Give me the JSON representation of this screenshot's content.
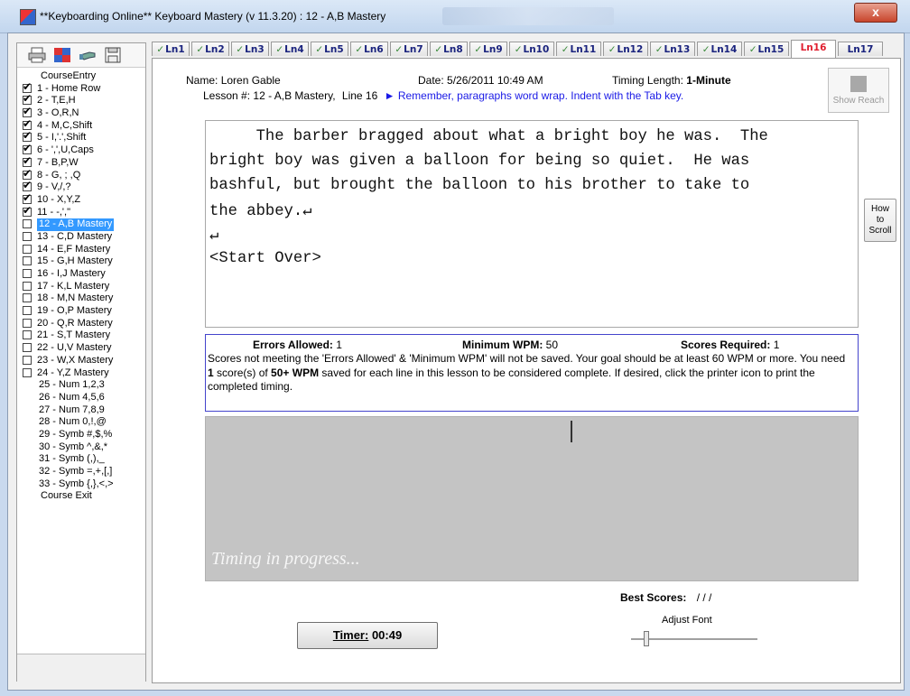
{
  "window": {
    "title": "**Keyboarding Online**  Keyboard Mastery (v 11.3.20) : 12 - A,B Mastery",
    "close_glyph": "x"
  },
  "toolbar": {
    "icons": [
      "printer-icon",
      "puzzle-icon",
      "hand-pointer-icon",
      "save-icon"
    ]
  },
  "sidebar": {
    "items": [
      {
        "label": "CourseEntry",
        "checkbox": false,
        "checked": false
      },
      {
        "label": "1 - Home Row",
        "checkbox": true,
        "checked": true
      },
      {
        "label": "2 - T,E,H",
        "checkbox": true,
        "checked": true
      },
      {
        "label": "3 - O,R,N",
        "checkbox": true,
        "checked": true
      },
      {
        "label": "4 - M,C,Shift",
        "checkbox": true,
        "checked": true
      },
      {
        "label": "5 - I,'.',Shift",
        "checkbox": true,
        "checked": true
      },
      {
        "label": "6 - ',',U,Caps",
        "checkbox": true,
        "checked": true
      },
      {
        "label": "7 - B,P,W",
        "checkbox": true,
        "checked": true
      },
      {
        "label": "8 - G, ; ,Q",
        "checkbox": true,
        "checked": true
      },
      {
        "label": "9 - V,/,?",
        "checkbox": true,
        "checked": true
      },
      {
        "label": "10 - X,Y,Z",
        "checkbox": true,
        "checked": true
      },
      {
        "label": "11 - -,',\"",
        "checkbox": true,
        "checked": true
      },
      {
        "label": "12 - A,B Mastery",
        "checkbox": true,
        "checked": false,
        "selected": true
      },
      {
        "label": "13 - C,D Mastery",
        "checkbox": true,
        "checked": false
      },
      {
        "label": "14 - E,F Mastery",
        "checkbox": true,
        "checked": false
      },
      {
        "label": "15 - G,H Mastery",
        "checkbox": true,
        "checked": false
      },
      {
        "label": "16 - I,J Mastery",
        "checkbox": true,
        "checked": false
      },
      {
        "label": "17 - K,L Mastery",
        "checkbox": true,
        "checked": false
      },
      {
        "label": "18 - M,N Mastery",
        "checkbox": true,
        "checked": false
      },
      {
        "label": "19 - O,P Mastery",
        "checkbox": true,
        "checked": false
      },
      {
        "label": "20 - Q,R Mastery",
        "checkbox": true,
        "checked": false
      },
      {
        "label": "21 - S,T Mastery",
        "checkbox": true,
        "checked": false
      },
      {
        "label": "22 - U,V Mastery",
        "checkbox": true,
        "checked": false
      },
      {
        "label": "23 - W,X Mastery",
        "checkbox": true,
        "checked": false
      },
      {
        "label": "24 - Y,Z Mastery",
        "checkbox": true,
        "checked": false
      },
      {
        "label": "25 - Num 1,2,3",
        "checkbox": false,
        "checked": false
      },
      {
        "label": "26 - Num 4,5,6",
        "checkbox": false,
        "checked": false
      },
      {
        "label": "27 - Num 7,8,9",
        "checkbox": false,
        "checked": false
      },
      {
        "label": "28 - Num 0,!,@",
        "checkbox": false,
        "checked": false
      },
      {
        "label": "29 - Symb #,$,%",
        "checkbox": false,
        "checked": false
      },
      {
        "label": "30 - Symb ^,&,*",
        "checkbox": false,
        "checked": false
      },
      {
        "label": "31 - Symb (,),_",
        "checkbox": false,
        "checked": false
      },
      {
        "label": "32 - Symb =,+,[,]",
        "checkbox": false,
        "checked": false
      },
      {
        "label": "33 - Symb {,},<,>",
        "checkbox": false,
        "checked": false
      },
      {
        "label": "Course Exit",
        "checkbox": false,
        "checked": false
      }
    ]
  },
  "tabs": [
    {
      "label": "Ln1",
      "done": true
    },
    {
      "label": "Ln2",
      "done": true
    },
    {
      "label": "Ln3",
      "done": true
    },
    {
      "label": "Ln4",
      "done": true
    },
    {
      "label": "Ln5",
      "done": true
    },
    {
      "label": "Ln6",
      "done": true
    },
    {
      "label": "Ln7",
      "done": true
    },
    {
      "label": "Ln8",
      "done": true
    },
    {
      "label": "Ln9",
      "done": true
    },
    {
      "label": "Ln10",
      "done": true
    },
    {
      "label": "Ln11",
      "done": true
    },
    {
      "label": "Ln12",
      "done": true
    },
    {
      "label": "Ln13",
      "done": true
    },
    {
      "label": "Ln14",
      "done": true
    },
    {
      "label": "Ln15",
      "done": true
    },
    {
      "label": "Ln16",
      "done": false,
      "active": true
    },
    {
      "label": "Ln17",
      "done": false
    }
  ],
  "header": {
    "name_label": "Name:",
    "name_value": "Loren Gable",
    "date_label": "Date:",
    "date_value": "5/26/2011 10:49 AM",
    "timing_label": "Timing Length:",
    "timing_value": "1-Minute",
    "lesson_label": "Lesson #:",
    "lesson_value": "12 - A,B Mastery,",
    "line_value": "Line 16",
    "hint": "► Remember, paragraphs word wrap. Indent with the Tab key."
  },
  "show_reach_label": "Show Reach",
  "how_to_scroll_label": [
    "How",
    "to",
    "Scroll"
  ],
  "passage": {
    "lines": [
      "     The barber bragged about what a bright boy he was.  The",
      "bright boy was given a balloon for being so quiet.  He was",
      "bashful, but brought the balloon to his brother to take to",
      "the abbey.↵",
      "↵",
      "<Start Over>"
    ]
  },
  "requirements": {
    "errors_label": "Errors Allowed:",
    "errors_value": "1",
    "wpm_label": "Minimum WPM:",
    "wpm_value": "50",
    "scores_label": "Scores Required:",
    "scores_value": "1",
    "text_1": "Scores not meeting the 'Errors Allowed' & 'Minimum WPM' will not be saved. Your goal should be at least 60 WPM or more. You need ",
    "text_bold_1": "1",
    "text_2": " score(s) of ",
    "text_bold_2": "50+ WPM",
    "text_3": " saved for each line in this lesson to be considered complete. If desired, click the printer icon to print the completed timing."
  },
  "progress": {
    "message": "Timing in progress..."
  },
  "best_scores": {
    "label": "Best Scores:",
    "value": "/  /  /"
  },
  "adjust_font_label": "Adjust Font",
  "timer": {
    "label": "Timer:",
    "value": "00:49"
  }
}
